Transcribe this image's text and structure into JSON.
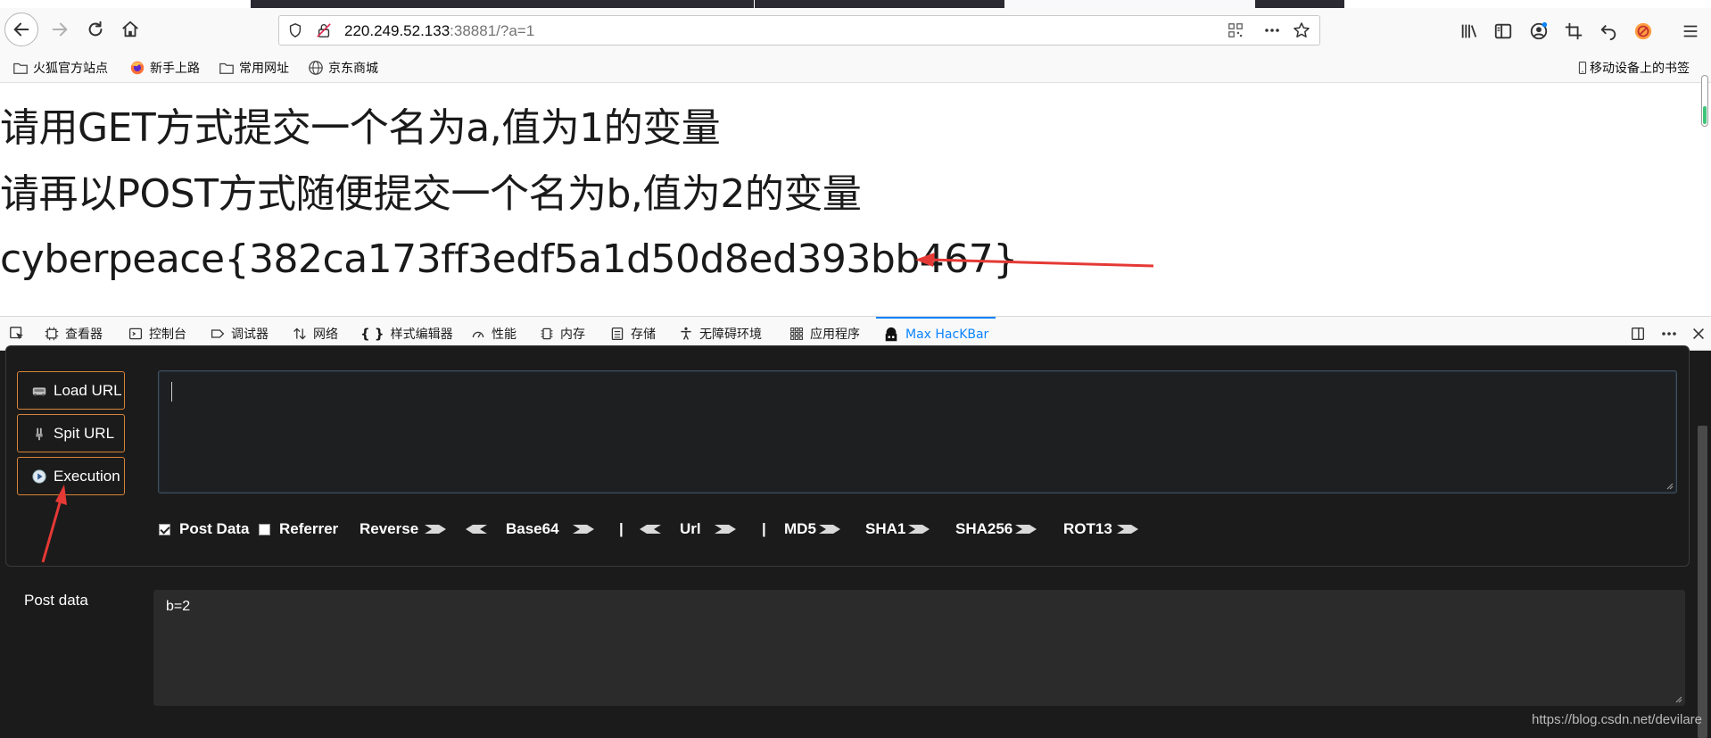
{
  "browser": {
    "url_host": "220.249.52.133",
    "url_rest": ":38881/?a=1",
    "bookmarks": [
      {
        "label": "火狐官方站点",
        "icon": "folder-icon"
      },
      {
        "label": "新手上路",
        "icon": "firefox-icon"
      },
      {
        "label": "常用网址",
        "icon": "folder-icon"
      },
      {
        "label": "京东商城",
        "icon": "globe-icon"
      }
    ],
    "mobile_bookmarks": "移动设备上的书签"
  },
  "page": {
    "line1": "请用GET方式提交一个名为a,值为1的变量",
    "line2": "请再以POST方式随便提交一个名为b,值为2的变量",
    "flag": "cyberpeace{382ca173ff3edf5a1d50d8ed393bb467}"
  },
  "devtools": {
    "tabs": [
      {
        "label": "查看器",
        "icon": "inspector-icon"
      },
      {
        "label": "控制台",
        "icon": "console-icon"
      },
      {
        "label": "调试器",
        "icon": "debugger-icon"
      },
      {
        "label": "网络",
        "icon": "network-icon"
      },
      {
        "label": "样式编辑器",
        "icon": "style-editor-icon"
      },
      {
        "label": "性能",
        "icon": "performance-icon"
      },
      {
        "label": "内存",
        "icon": "memory-icon"
      },
      {
        "label": "存储",
        "icon": "storage-icon"
      },
      {
        "label": "无障碍环境",
        "icon": "accessibility-icon"
      },
      {
        "label": "应用程序",
        "icon": "application-icon"
      },
      {
        "label": "Max HacKBar",
        "icon": "hackbar-icon"
      }
    ],
    "active_tab": "Max HacKBar"
  },
  "hackbar": {
    "buttons": {
      "load_url": "Load URL",
      "split_url": "Spit URL",
      "execution": "Execution"
    },
    "url_value": "",
    "options": {
      "post_data": {
        "label": "Post Data",
        "checked": true
      },
      "referrer": {
        "label": "Referrer",
        "checked": false
      },
      "reverse": "Reverse",
      "base64": "Base64",
      "separator": "|",
      "url": "Url",
      "md5": "MD5",
      "sha1": "SHA1",
      "sha256": "SHA256",
      "rot13": "ROT13"
    },
    "post_label": "Post data",
    "post_value": "b=2"
  },
  "watermark": "https://blog.csdn.net/devilare",
  "colors": {
    "accent": "#0a84ff",
    "button_border": "#d8843a",
    "annotation": "#e53935",
    "hackbar_bg": "#1b1b1b"
  }
}
